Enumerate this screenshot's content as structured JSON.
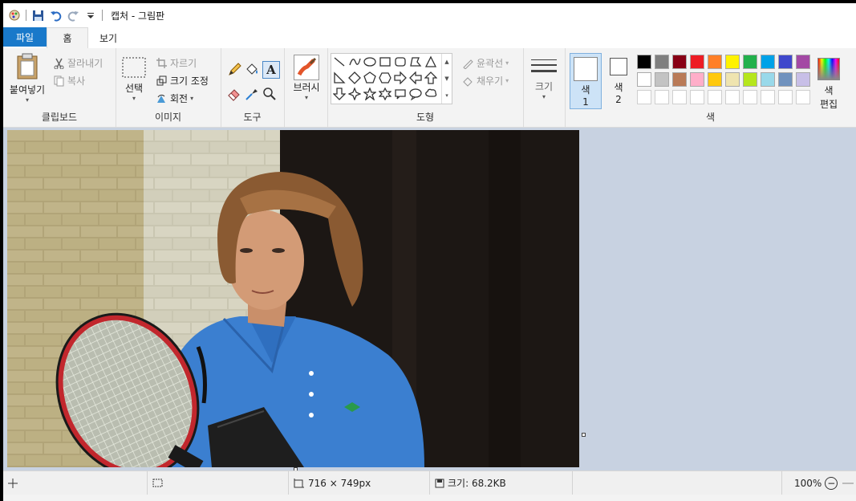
{
  "window": {
    "title": "캡처 - 그림판"
  },
  "tabs": {
    "file": "파일",
    "home": "홈",
    "view": "보기"
  },
  "clipboard": {
    "paste": "붙여넣기",
    "cut": "잘라내기",
    "copy": "복사",
    "label": "클립보드"
  },
  "image": {
    "select": "선택",
    "crop": "자르기",
    "resize": "크기 조정",
    "rotate": "회전",
    "label": "이미지"
  },
  "tools": {
    "label": "도구",
    "text_glyph": "A"
  },
  "brushes": {
    "label": "브러시"
  },
  "shapes": {
    "outline": "윤곽선",
    "fill": "채우기",
    "label": "도형"
  },
  "size": {
    "label": "크기"
  },
  "colors": {
    "color1": "색",
    "color1_num": "1",
    "color2": "색",
    "color2_num": "2",
    "edit": "색\n편집",
    "edit_line1": "색",
    "edit_line2": "편집",
    "label": "색",
    "row1": [
      "#000000",
      "#7f7f7f",
      "#880015",
      "#ed1c24",
      "#ff7f27",
      "#fff200",
      "#22b14c",
      "#00a2e8",
      "#3f48cc",
      "#a349a4"
    ],
    "row2": [
      "#ffffff",
      "#c3c3c3",
      "#b97a57",
      "#ffaec9",
      "#ffc90e",
      "#efe4b0",
      "#b5e61d",
      "#99d9ea",
      "#7092be",
      "#c8bfe7"
    ],
    "row3": [
      "#ffffff",
      "#ffffff",
      "#ffffff",
      "#ffffff",
      "#ffffff",
      "#ffffff",
      "#ffffff",
      "#ffffff",
      "#ffffff",
      "#ffffff"
    ]
  },
  "status": {
    "dimensions": "716 × 749px",
    "filesize": "크기: 68.2KB",
    "zoom": "100%"
  }
}
